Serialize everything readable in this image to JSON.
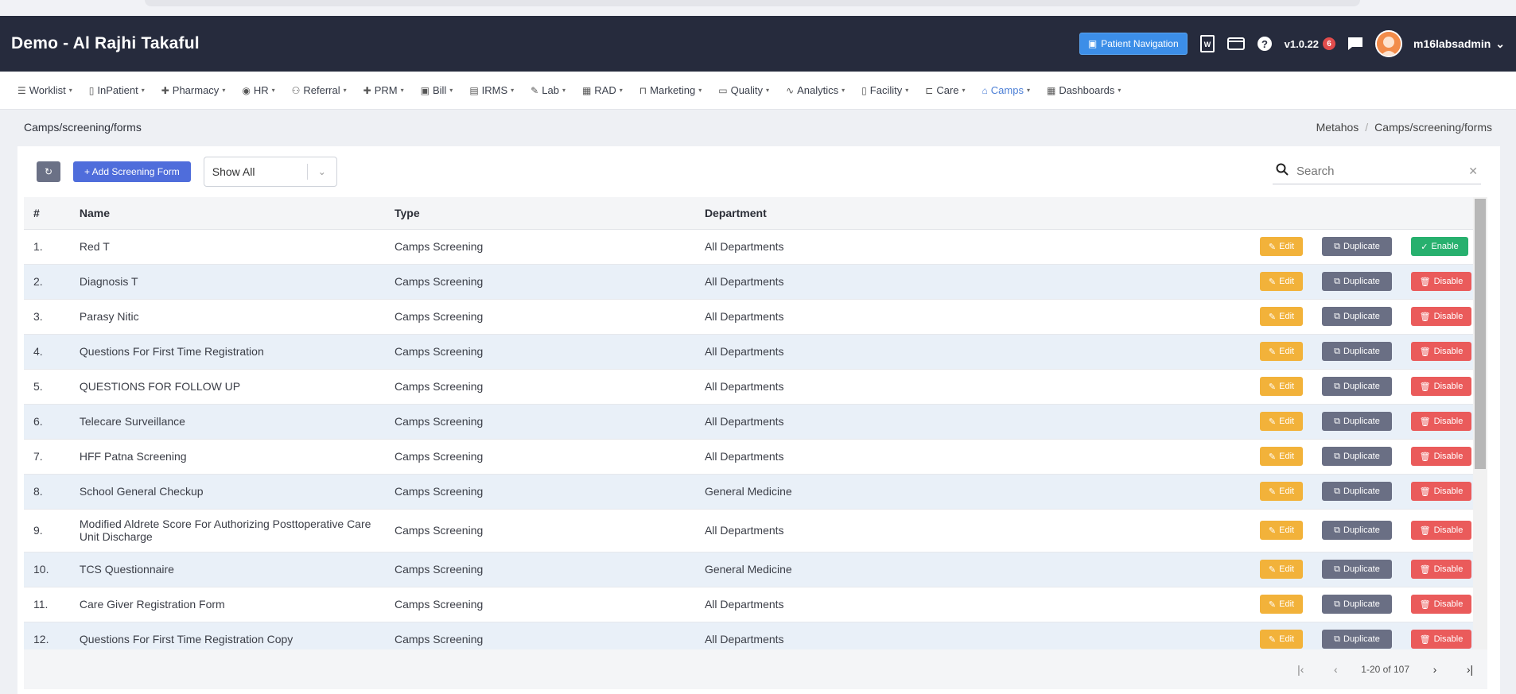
{
  "app": {
    "title": "Demo - Al Rajhi Takaful",
    "patient_nav_label": "Patient Navigation",
    "version": "v1.0.22",
    "notification_count": "6",
    "username": "m16labsadmin"
  },
  "menu": [
    {
      "label": "Worklist",
      "icon": "list-icon",
      "glyph": "☰"
    },
    {
      "label": "InPatient",
      "icon": "document-icon",
      "glyph": "▯"
    },
    {
      "label": "Pharmacy",
      "icon": "plus-icon",
      "glyph": "✚"
    },
    {
      "label": "HR",
      "icon": "user-circle-icon",
      "glyph": "◉"
    },
    {
      "label": "Referral",
      "icon": "users-icon",
      "glyph": "⚇"
    },
    {
      "label": "PRM",
      "icon": "plus-icon",
      "glyph": "✚"
    },
    {
      "label": "Bill",
      "icon": "wallet-icon",
      "glyph": "▣"
    },
    {
      "label": "IRMS",
      "icon": "card-icon",
      "glyph": "▤"
    },
    {
      "label": "Lab",
      "icon": "pen-icon",
      "glyph": "✎"
    },
    {
      "label": "RAD",
      "icon": "film-icon",
      "glyph": "▦"
    },
    {
      "label": "Marketing",
      "icon": "bag-icon",
      "glyph": "⊓"
    },
    {
      "label": "Quality",
      "icon": "badge-icon",
      "glyph": "▭"
    },
    {
      "label": "Analytics",
      "icon": "pulse-icon",
      "glyph": "∿"
    },
    {
      "label": "Facility",
      "icon": "file-icon",
      "glyph": "▯"
    },
    {
      "label": "Care",
      "icon": "bed-icon",
      "glyph": "⊏"
    },
    {
      "label": "Camps",
      "icon": "tent-icon",
      "glyph": "⌂",
      "active": true
    },
    {
      "label": "Dashboards",
      "icon": "grid-icon",
      "glyph": "▦"
    }
  ],
  "page": {
    "heading": "Camps/screening/forms",
    "crumb_root": "Metahos",
    "crumb_current": "Camps/screening/forms"
  },
  "toolbar": {
    "add_label": "+ Add Screening Form",
    "filter_value": "Show All",
    "search_placeholder": "Search"
  },
  "table": {
    "headers": {
      "num": "#",
      "name": "Name",
      "type": "Type",
      "department": "Department"
    },
    "edit_label": "Edit",
    "duplicate_label": "Duplicate",
    "disable_label": "Disable",
    "enable_label": "Enable",
    "rows": [
      {
        "num": "1.",
        "name": "Red T",
        "type": "Camps Screening",
        "department": "All Departments",
        "status_action": "Enable"
      },
      {
        "num": "2.",
        "name": "Diagnosis T",
        "type": "Camps Screening",
        "department": "All Departments",
        "status_action": "Disable"
      },
      {
        "num": "3.",
        "name": "Parasy Nitic",
        "type": "Camps Screening",
        "department": "All Departments",
        "status_action": "Disable"
      },
      {
        "num": "4.",
        "name": "Questions For First Time Registration",
        "type": "Camps Screening",
        "department": "All Departments",
        "status_action": "Disable"
      },
      {
        "num": "5.",
        "name": "QUESTIONS FOR FOLLOW UP",
        "type": "Camps Screening",
        "department": "All Departments",
        "status_action": "Disable"
      },
      {
        "num": "6.",
        "name": "Telecare Surveillance",
        "type": "Camps Screening",
        "department": "All Departments",
        "status_action": "Disable"
      },
      {
        "num": "7.",
        "name": "HFF Patna Screening",
        "type": "Camps Screening",
        "department": "All Departments",
        "status_action": "Disable"
      },
      {
        "num": "8.",
        "name": "School General Checkup",
        "type": "Camps Screening",
        "department": "General Medicine",
        "status_action": "Disable"
      },
      {
        "num": "9.",
        "name": "Modified Aldrete Score For Authorizing Posttoperative Care Unit Discharge",
        "type": "Camps Screening",
        "department": "All Departments",
        "status_action": "Disable"
      },
      {
        "num": "10.",
        "name": "TCS Questionnaire",
        "type": "Camps Screening",
        "department": "General Medicine",
        "status_action": "Disable"
      },
      {
        "num": "11.",
        "name": "Care Giver Registration Form",
        "type": "Camps Screening",
        "department": "All Departments",
        "status_action": "Disable"
      },
      {
        "num": "12.",
        "name": "Questions For First Time Registration Copy",
        "type": "Camps Screening",
        "department": "All Departments",
        "status_action": "Disable"
      }
    ]
  },
  "pager": {
    "range": "1-20 of 107"
  }
}
